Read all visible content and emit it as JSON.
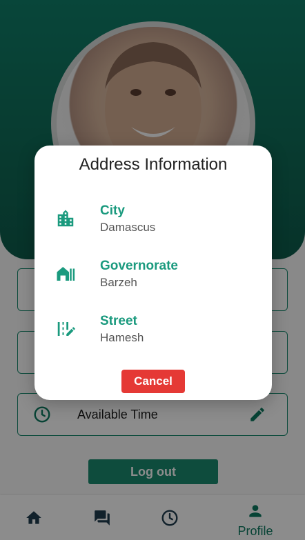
{
  "colors": {
    "primary": "#1a8a6f",
    "accent_text": "#1a9a7e",
    "danger": "#e53935"
  },
  "profile": {
    "avatar_icon": "user-photo",
    "fields": [
      {
        "icon": "phone-icon",
        "label": ""
      },
      {
        "icon": "location-icon",
        "label": ""
      },
      {
        "icon": "clock-icon",
        "label": "Available Time"
      }
    ],
    "logout_label": "Log out"
  },
  "nav": {
    "items": [
      {
        "icon": "home-icon",
        "label": ""
      },
      {
        "icon": "chat-icon",
        "label": ""
      },
      {
        "icon": "clock-icon",
        "label": ""
      },
      {
        "icon": "person-icon",
        "label": "Profile"
      }
    ]
  },
  "modal": {
    "title": "Address Information",
    "rows": [
      {
        "icon": "city-icon",
        "label": "City",
        "value": "Damascus"
      },
      {
        "icon": "governorate-icon",
        "label": "Governorate",
        "value": "Barzeh"
      },
      {
        "icon": "street-icon",
        "label": "Street",
        "value": "Hamesh"
      }
    ],
    "cancel_label": "Cancel"
  }
}
